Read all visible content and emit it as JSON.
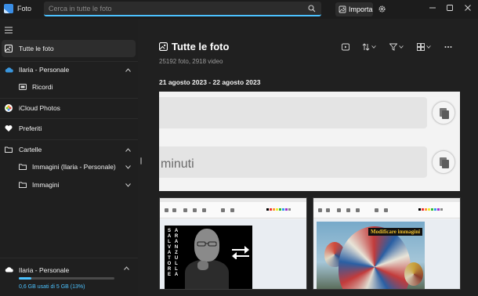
{
  "app": {
    "title": "Foto"
  },
  "search": {
    "placeholder": "Cerca in tutte le foto"
  },
  "toolbar": {
    "import_label": "Importa"
  },
  "sidebar": {
    "items": [
      {
        "label": "Tutte le foto"
      },
      {
        "label": "Ilaria - Personale"
      },
      {
        "label": "Ricordi"
      },
      {
        "label": "iCloud Photos"
      },
      {
        "label": "Preferiti"
      },
      {
        "label": "Cartelle"
      },
      {
        "label": "Immagini (Ilaria - Personale)"
      },
      {
        "label": "Immagini"
      }
    ],
    "storage": {
      "account": "Ilaria - Personale",
      "usage": "0,6 GB usati di 5 GB (13%)",
      "fraction": 0.13
    }
  },
  "main": {
    "title": "Tutte le foto",
    "counts": "25192 foto, 2918 video",
    "date_range": "21 agosto 2023 - 22 agosto 2023",
    "screenshot_text": "minuti",
    "thumb1_text": [
      "SALVATORE",
      "ARANZULLA"
    ],
    "thumb2_overlay": "Modificare immagini"
  },
  "colors": {
    "accent": "#4cc2ff",
    "background": "#202020",
    "sidebar": "#1f1f1f"
  }
}
